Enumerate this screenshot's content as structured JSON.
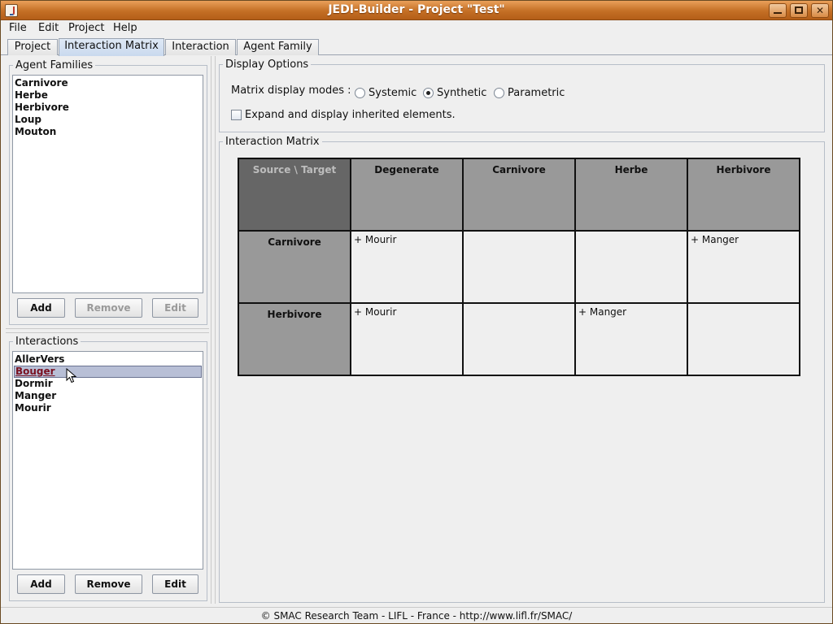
{
  "window": {
    "title": "JEDI-Builder - Project \"Test\""
  },
  "menubar": {
    "items": [
      "File",
      "Edit",
      "Project",
      "Help"
    ]
  },
  "tabs": {
    "items": [
      "Project",
      "Interaction Matrix",
      "Interaction",
      "Agent Family"
    ],
    "active": "Interaction Matrix"
  },
  "agent_families": {
    "title": "Agent Families",
    "items": [
      "Carnivore",
      "Herbe",
      "Herbivore",
      "Loup",
      "Mouton"
    ],
    "add_label": "Add",
    "remove_label": "Remove",
    "edit_label": "Edit"
  },
  "interactions": {
    "title": "Interactions",
    "items": [
      "AllerVers",
      "Bouger",
      "Dormir",
      "Manger",
      "Mourir"
    ],
    "selected": "Bouger",
    "add_label": "Add",
    "remove_label": "Remove",
    "edit_label": "Edit"
  },
  "display_options": {
    "title": "Display Options",
    "modes_label": "Matrix display modes :",
    "modes": [
      "Systemic",
      "Synthetic",
      "Parametric"
    ],
    "selected_mode": "Synthetic",
    "expand_label": "Expand and display inherited elements.",
    "expand_checked": false
  },
  "matrix": {
    "title": "Interaction Matrix",
    "corner": "Source \\ Target",
    "columns": [
      "Degenerate",
      "Carnivore",
      "Herbe",
      "Herbivore"
    ],
    "rows": [
      {
        "source": "Carnivore",
        "cells": [
          "+ Mourir",
          "",
          "",
          "+ Manger"
        ]
      },
      {
        "source": "Herbivore",
        "cells": [
          "+ Mourir",
          "",
          "+ Manger",
          ""
        ]
      }
    ]
  },
  "status": {
    "text": "© SMAC Research Team - LIFL - France - http://www.lifl.fr/SMAC/"
  },
  "colors": {
    "titlebar": "#c46f25",
    "selection": "#b8bfd6",
    "matrix_corner": "#666666",
    "matrix_header": "#999999"
  }
}
